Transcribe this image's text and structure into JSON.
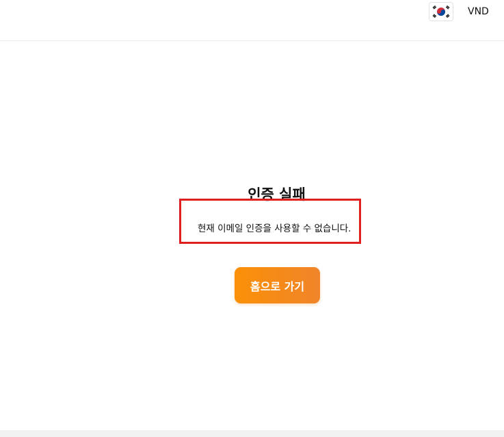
{
  "header": {
    "language_flag_icon": "korea-flag-icon",
    "currency": "VND"
  },
  "main": {
    "title": "인증 실패",
    "message": "현재 이메일 인증을 사용할 수 없습니다.",
    "home_button_label": "홈으로 가기"
  },
  "colors": {
    "accent": "#fb9008",
    "highlight": "#e02020"
  }
}
